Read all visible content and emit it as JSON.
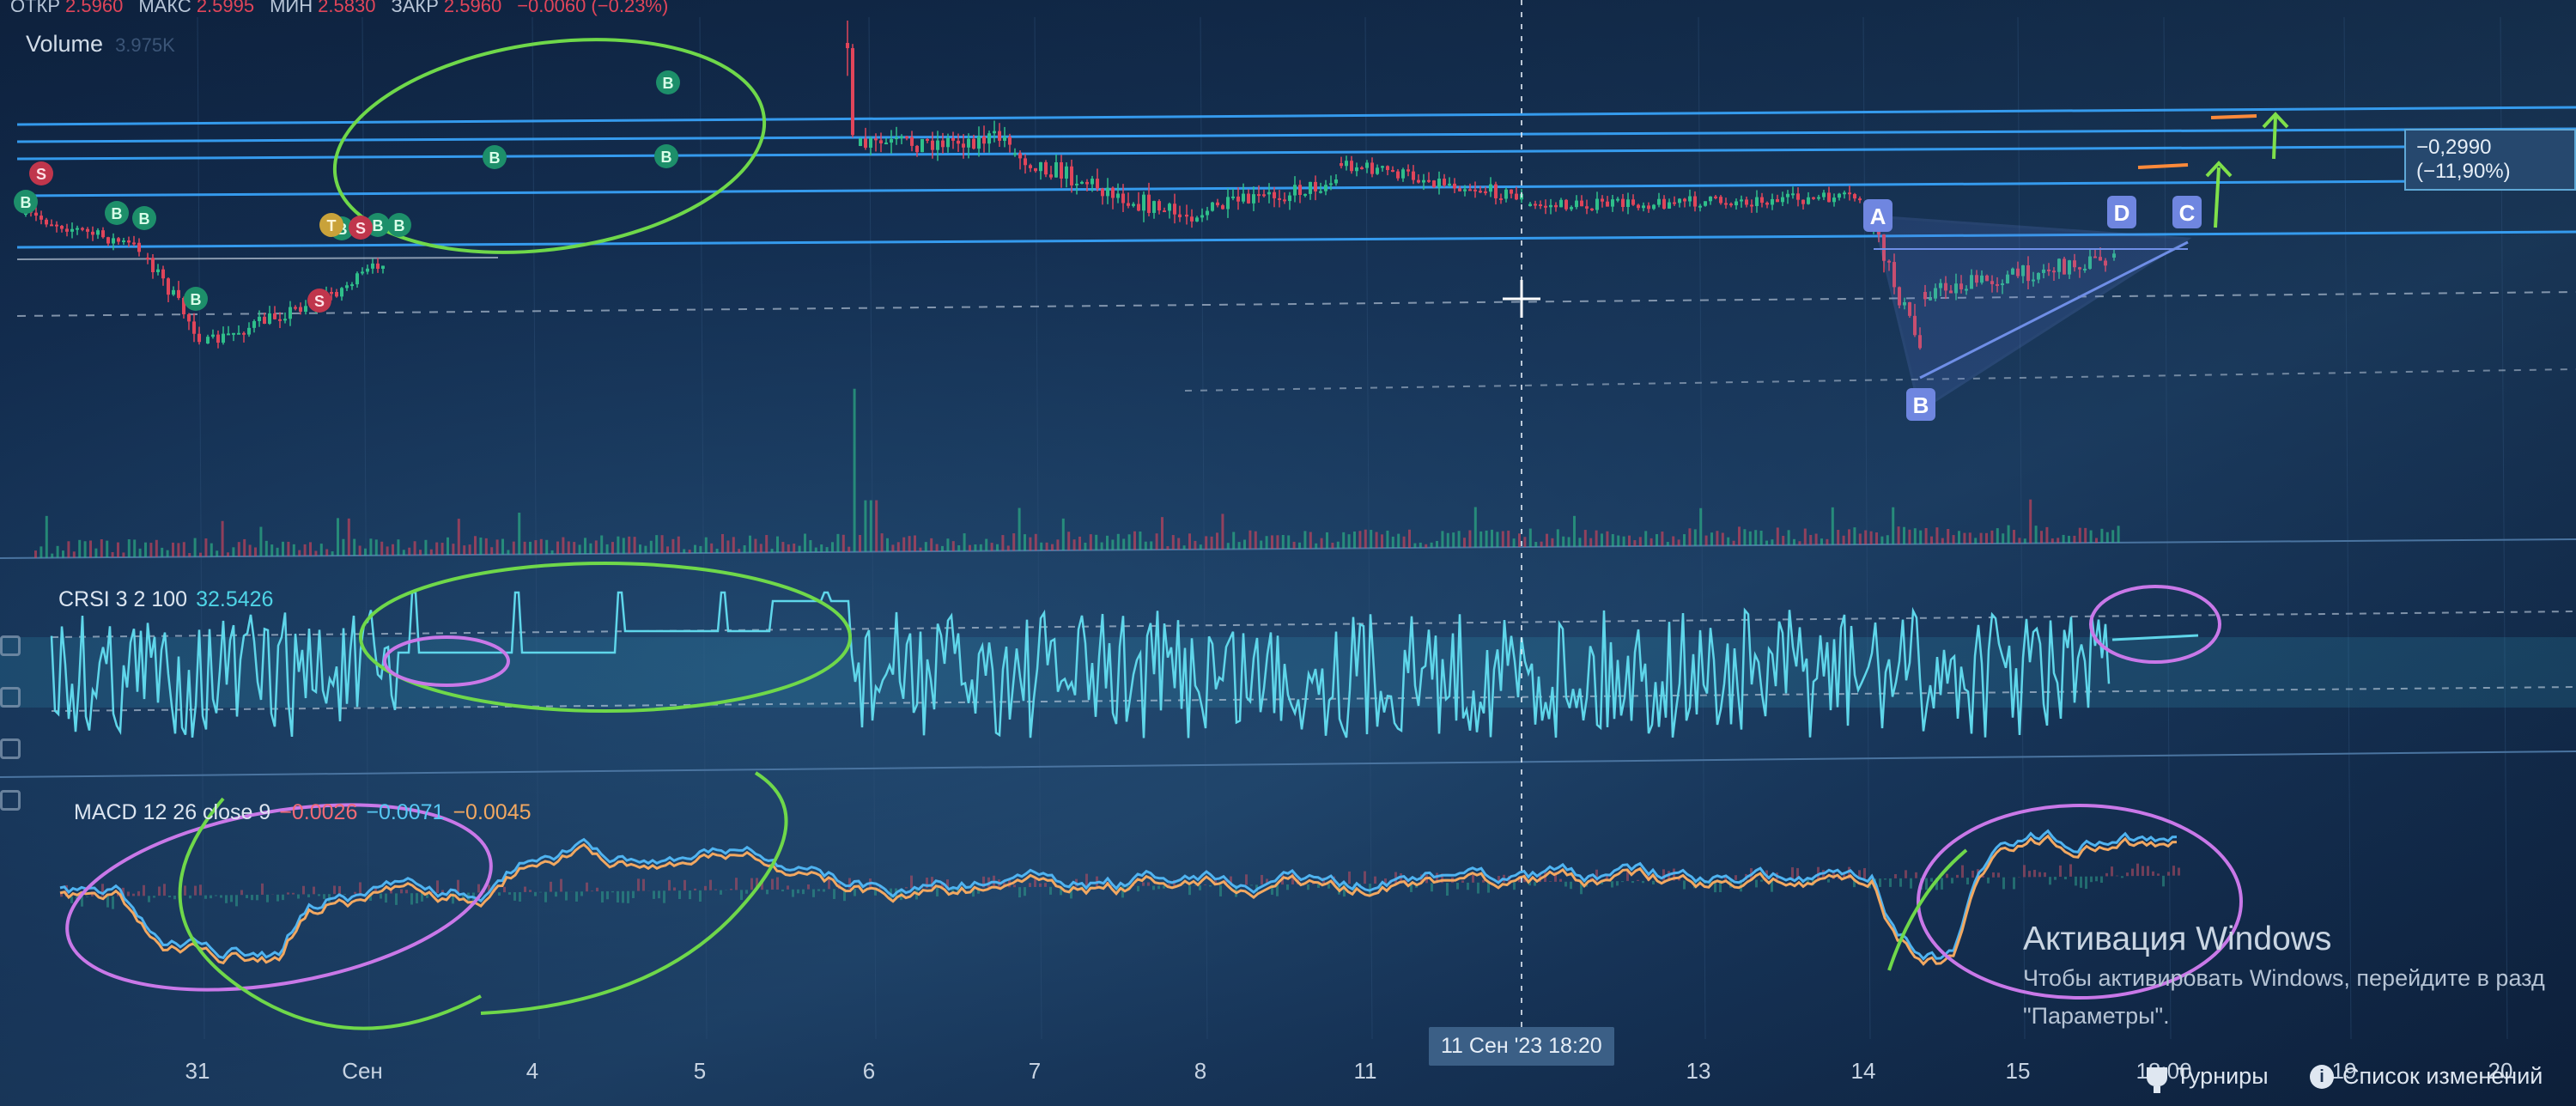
{
  "header": {
    "ohlc": [
      {
        "label": "ОТКР",
        "value": "2.5960"
      },
      {
        "label": "МАКС",
        "value": "2.5995"
      },
      {
        "label": "МИН",
        "value": "2.5830"
      },
      {
        "label": "ЗАКР",
        "value": "2.5960"
      }
    ],
    "change": "−0.0060 (−0.23%)",
    "volume_label": "Volume",
    "volume_value": "3.975K"
  },
  "price_tag": "−0,2990 (−11,90%)",
  "pattern_labels": [
    "A",
    "B",
    "C",
    "D"
  ],
  "signal_markers": [
    "B",
    "S",
    "T"
  ],
  "indicators": {
    "crsi": {
      "label": "CRSI 3 2 100",
      "value": "32.5426"
    },
    "macd": {
      "label": "MACD 12 26 close 9",
      "histogram": "−0.0026",
      "macd": "−0.0071",
      "signal": "−0.0045"
    }
  },
  "time_axis": {
    "ticks": [
      "31",
      "Сен",
      "4",
      "5",
      "6",
      "7",
      "8",
      "11",
      "13",
      "14",
      "15",
      "18:00",
      "19",
      "20"
    ],
    "cursor_label": "11 Сен '23   18:20"
  },
  "watermark": {
    "title": "Активация Windows",
    "line1": "Чтобы активировать Windows, перейдите в разд",
    "line2": "\"Параметры\"."
  },
  "footer": {
    "tournaments": "Турниры",
    "changelog": "Список изменений"
  },
  "colors": {
    "background": "#11294a",
    "candle_up": "#2fbf8a",
    "candle_down": "#e0455a",
    "crsi_line": "#5fd6ea",
    "macd_line": "#4fb3f0",
    "signal_line": "#f2a861",
    "level_line": "#39a7ff",
    "annotation_green": "#6fd84a",
    "annotation_pink": "#c978e8",
    "pattern_fill": "#5b78d6"
  },
  "chart_data": {
    "type": "line",
    "price_series": {
      "x_ticks": [
        "31",
        "Сен",
        "4",
        "5",
        "6",
        "7",
        "8",
        "11",
        "13",
        "14",
        "15",
        "18:00",
        "19",
        "20"
      ]
    },
    "crsi": {
      "value": 32.5426,
      "band_upper": 70,
      "band_lower": 30
    },
    "macd": {
      "histogram": -0.0026,
      "macd": -0.0071,
      "signal": -0.0045
    }
  }
}
